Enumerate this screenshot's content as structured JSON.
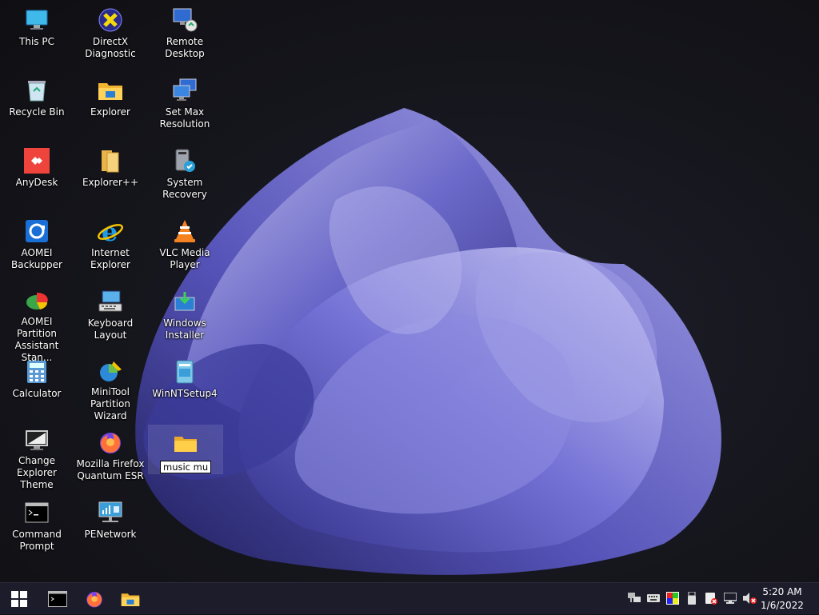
{
  "desktop": {
    "icons": [
      {
        "label": "This PC",
        "icon": "monitor-icon"
      },
      {
        "label": "DirectX\nDiagnostic",
        "icon": "directx-icon"
      },
      {
        "label": "Remote Desktop",
        "icon": "remote-desktop-icon"
      },
      {
        "label": "Recycle Bin",
        "icon": "recycle-bin-icon"
      },
      {
        "label": "Explorer",
        "icon": "folder-explorer-icon"
      },
      {
        "label": "Set Max\nResolution",
        "icon": "display-settings-icon"
      },
      {
        "label": "AnyDesk",
        "icon": "anydesk-icon"
      },
      {
        "label": "Explorer++",
        "icon": "explorer-plus-icon"
      },
      {
        "label": "System Recovery",
        "icon": "system-recovery-icon"
      },
      {
        "label": "AOMEI\nBackupper",
        "icon": "aomei-backupper-icon"
      },
      {
        "label": "Internet Explorer",
        "icon": "internet-explorer-icon"
      },
      {
        "label": "VLC Media\nPlayer",
        "icon": "vlc-icon"
      },
      {
        "label": "AOMEI Partition\nAssistant Stan...",
        "icon": "aomei-partition-icon"
      },
      {
        "label": "Keyboard Layout",
        "icon": "keyboard-icon"
      },
      {
        "label": "Windows\nInstaller",
        "icon": "windows-installer-icon"
      },
      {
        "label": "Calculator",
        "icon": "calculator-icon"
      },
      {
        "label": "MiniTool\nPartition Wizard",
        "icon": "minitool-icon"
      },
      {
        "label": "WinNTSetup4",
        "icon": "winntsetup-icon"
      },
      {
        "label": "Change Explorer\nTheme",
        "icon": "theme-monitor-icon"
      },
      {
        "label": "Mozilla Firefox\nQuantum ESR",
        "icon": "firefox-icon"
      },
      {
        "label": "Command\nPrompt",
        "icon": "cmd-icon"
      },
      {
        "label": "PENetwork",
        "icon": "network-icon"
      }
    ],
    "new_folder": {
      "rename_value": "music mus",
      "icon": "folder-icon"
    }
  },
  "taskbar": {
    "start": "windows-start-icon",
    "pinned": [
      "cmd-icon",
      "firefox-icon",
      "folder-explorer-icon"
    ],
    "tray": [
      "network-icon",
      "keyboard-icon",
      "color-icon",
      "usb-icon",
      "disk-icon",
      "display-icon",
      "volume-muted-icon"
    ],
    "time": "5:20 AM",
    "date": "1/6/2022"
  }
}
